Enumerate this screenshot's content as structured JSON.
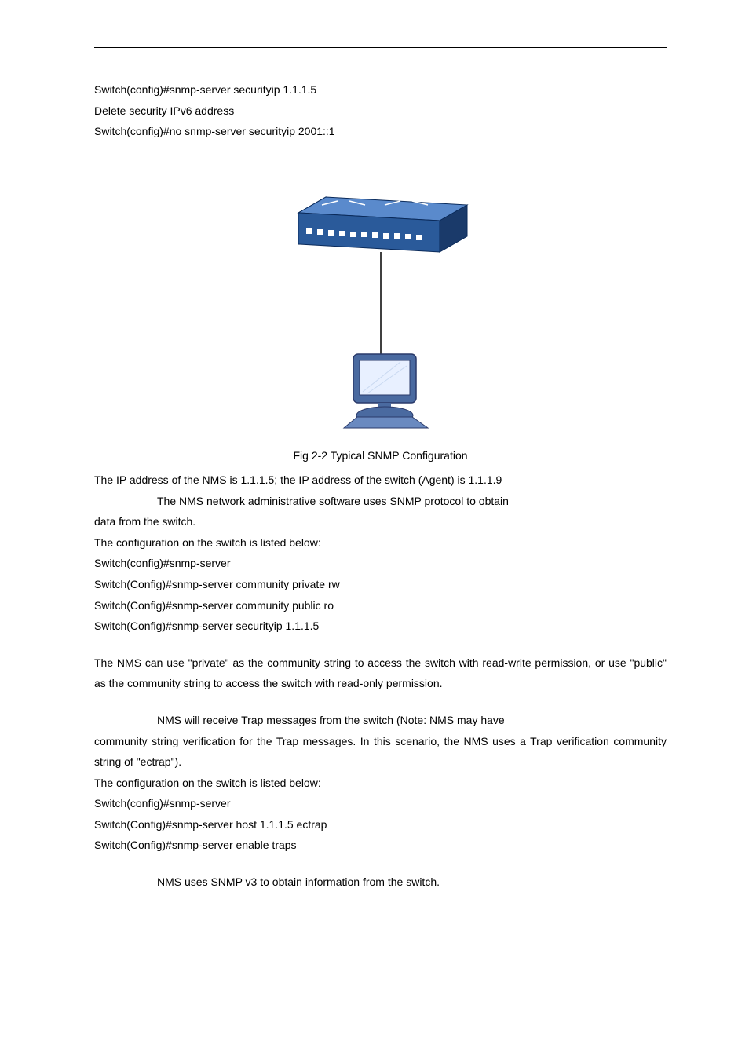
{
  "top": {
    "line1": "Switch(config)#snmp-server securityip 1.1.1.5",
    "line2": "Delete security IPv6 address",
    "line3": "Switch(config)#no snmp-server securityip 2001::1"
  },
  "figure": {
    "caption": "Fig 2-2 Typical SNMP Configuration"
  },
  "section1": {
    "ip_line": "The IP address of the NMS is 1.1.1.5; the IP address of the switch (Agent) is 1.1.1.9",
    "nms_desc_lead": "The NMS network administrative software uses SNMP protocol to obtain",
    "nms_desc_tail": "data from the switch.",
    "config_intro": "The configuration on the switch is listed below:",
    "cmd1": "Switch(config)#snmp-server",
    "cmd2": "Switch(Config)#snmp-server community private rw",
    "cmd3": "Switch(Config)#snmp-server community public ro",
    "cmd4": "Switch(Config)#snmp-server securityip 1.1.1.5"
  },
  "section2": {
    "desc": "The NMS can use \"private\" as the community string to access the switch with read-write permission, or use \"public\" as the community string to access the switch with read-only permission."
  },
  "section3": {
    "desc_lead": "NMS will receive Trap messages from the switch (Note: NMS may have",
    "desc_tail": "community string verification for the Trap messages. In this scenario, the NMS uses a Trap verification community string of \"ectrap\").",
    "config_intro": "The configuration on the switch is listed below:",
    "cmd1": "Switch(config)#snmp-server",
    "cmd2": "Switch(Config)#snmp-server host 1.1.1.5 ectrap",
    "cmd3": "Switch(Config)#snmp-server enable traps"
  },
  "section4": {
    "desc": "NMS uses SNMP v3 to obtain information from the switch."
  }
}
